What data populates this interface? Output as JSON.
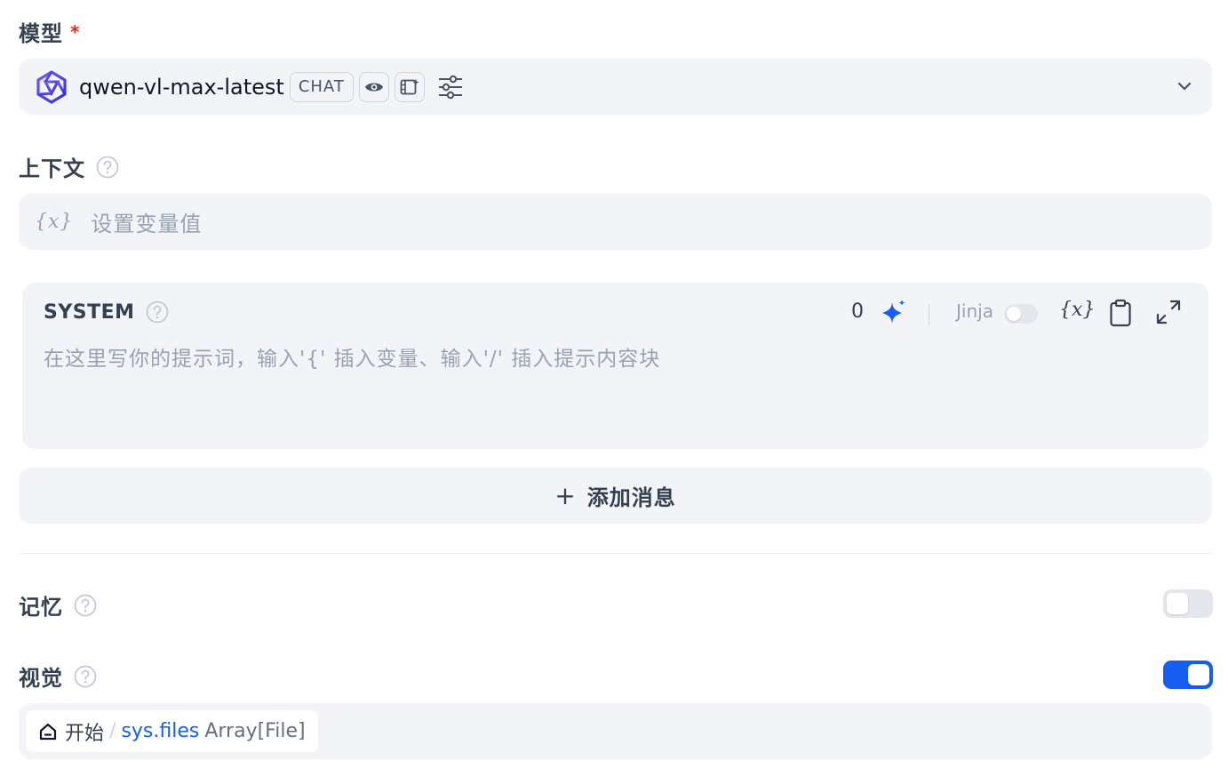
{
  "model": {
    "label": "模型",
    "required_mark": "*",
    "provider_logo": "qwen-logo-icon",
    "name": "qwen-vl-max-latest",
    "mode_badge": "CHAT",
    "capability_icons": [
      "eye-icon",
      "video-icon"
    ]
  },
  "context": {
    "label": "上下文",
    "var_glyph": "{x}",
    "placeholder": "设置变量值"
  },
  "system_prompt": {
    "role": "SYSTEM",
    "placeholder": "在这里写你的提示词，输入'{' 插入变量、输入'/' 插入提示内容块",
    "token_count": "0",
    "jinja_label": "Jinja",
    "jinja_enabled": false,
    "var_button": "{x}"
  },
  "add_message": {
    "plus": "+",
    "label": "添加消息"
  },
  "memory": {
    "label": "记忆",
    "enabled": false
  },
  "vision": {
    "label": "视觉",
    "enabled": true,
    "variable": {
      "node": "开始",
      "separator": "/",
      "name": "sys.files",
      "type": "Array[File]"
    }
  },
  "colors": {
    "accent": "#155eef",
    "field_bg": "#f2f4f7",
    "placeholder": "#98a2b3",
    "label": "#354052",
    "required": "#d92d20"
  }
}
